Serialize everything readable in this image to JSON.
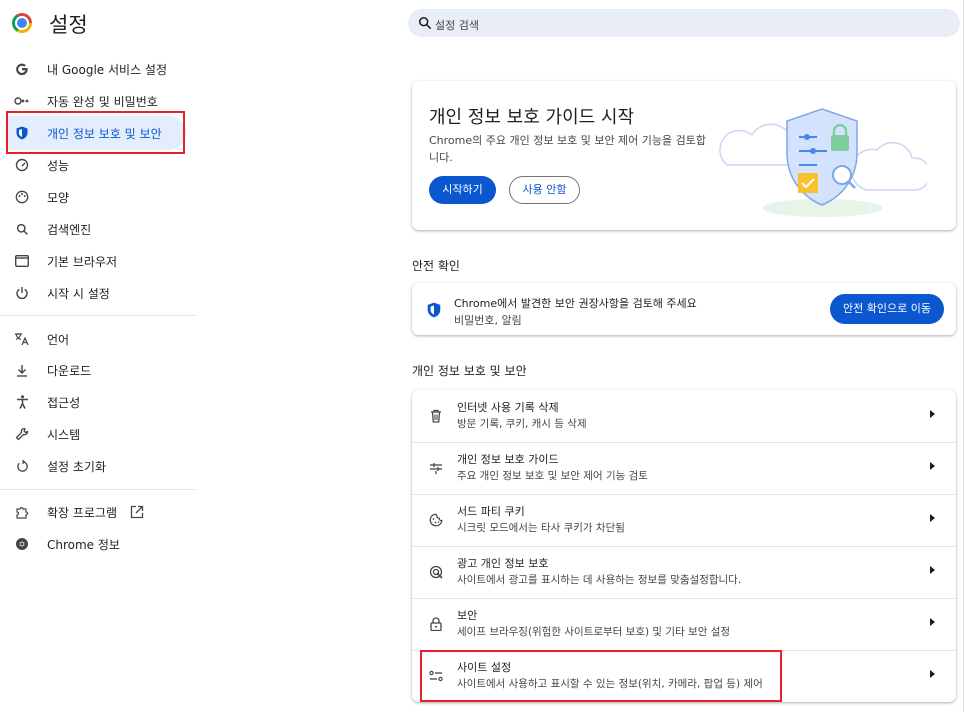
{
  "header": {
    "title": "설정",
    "search_placeholder": "설정 검색"
  },
  "sidebar": {
    "items": [
      {
        "label": "내 Google 서비스 설정",
        "icon": "google-g-icon"
      },
      {
        "label": "자동 완성 및 비밀번호",
        "icon": "key-icon"
      },
      {
        "label": "개인 정보 보호 및 보안",
        "icon": "shield-icon",
        "active": true
      },
      {
        "label": "성능",
        "icon": "speedometer-icon"
      },
      {
        "label": "모양",
        "icon": "palette-icon"
      },
      {
        "label": "검색엔진",
        "icon": "search-icon"
      },
      {
        "label": "기본 브라우저",
        "icon": "browser-window-icon"
      },
      {
        "label": "시작 시 설정",
        "icon": "power-icon"
      },
      {
        "label": "언어",
        "icon": "translate-icon"
      },
      {
        "label": "다운로드",
        "icon": "download-icon"
      },
      {
        "label": "접근성",
        "icon": "accessibility-icon"
      },
      {
        "label": "시스템",
        "icon": "wrench-icon"
      },
      {
        "label": "설정 초기화",
        "icon": "reset-icon"
      },
      {
        "label": "확장 프로그램",
        "icon": "puzzle-icon"
      },
      {
        "label": "Chrome 정보",
        "icon": "chrome-icon"
      }
    ]
  },
  "privacy_guide": {
    "title": "개인 정보 보호 가이드 시작",
    "description": "Chrome의 주요 개인 정보 보호 및 보안 제어 기능을 검토합니다.",
    "start_button": "시작하기",
    "dismiss_button": "사용 안함"
  },
  "safety_check": {
    "heading": "안전 확인",
    "message": "Chrome에서 발견한 보안 권장사항을 검토해 주세요",
    "detail": "비밀번호, 알림",
    "button": "안전 확인으로 이동"
  },
  "privacy_section": {
    "heading": "개인 정보 보호 및 보안",
    "rows": [
      {
        "title": "인터넷 사용 기록 삭제",
        "subtitle": "방문 기록, 쿠키, 캐시 등 삭제",
        "icon": "trash-icon"
      },
      {
        "title": "개인 정보 보호 가이드",
        "subtitle": "주요 개인 정보 보호 및 보안 제어 기능 검토",
        "icon": "privacy-guide-icon"
      },
      {
        "title": "서드 파티 쿠키",
        "subtitle": "시크릿 모드에서는 타사 쿠키가 차단됨",
        "icon": "cookie-icon"
      },
      {
        "title": "광고 개인 정보 보호",
        "subtitle": "사이트에서 광고를 표시하는 데 사용하는 정보를 맞춤설정합니다.",
        "icon": "ad-privacy-icon"
      },
      {
        "title": "보안",
        "subtitle": "세이프 브라우징(위험한 사이트로부터 보호) 및 기타 보안 설정",
        "icon": "lock-icon"
      },
      {
        "title": "사이트 설정",
        "subtitle": "사이트에서 사용하고 표시할 수 있는 정보(위치, 카메라, 팝업 등) 제어",
        "icon": "sliders-icon"
      }
    ]
  },
  "colors": {
    "accent": "#0b57d0",
    "active_bg": "#e4edfb",
    "highlight_box": "#e8202a"
  }
}
